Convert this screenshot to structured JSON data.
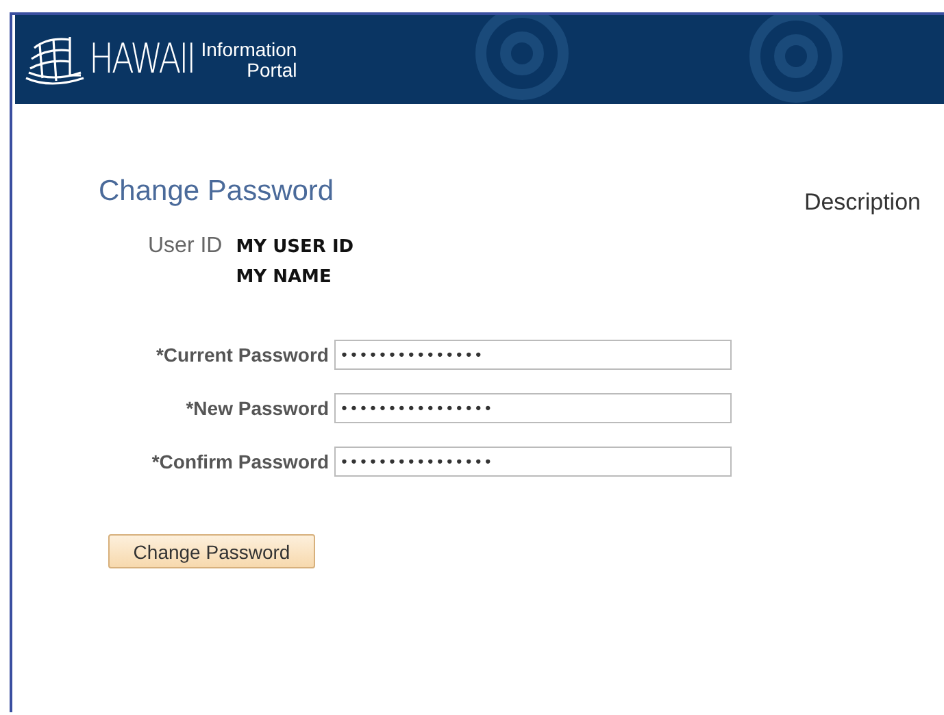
{
  "header": {
    "logo_word": "HAWAII",
    "logo_line_1": "Information",
    "logo_line_2": "Portal"
  },
  "page": {
    "title": "Change Password",
    "description_label": "Description"
  },
  "user": {
    "label": "User ID",
    "user_id": "MY USER ID",
    "name": "MY NAME"
  },
  "fields": [
    {
      "label": "*Current Password",
      "value": "•••••••••••••••"
    },
    {
      "label": "*New Password",
      "value": "••••••••••••••••"
    },
    {
      "label": "*Confirm Password",
      "value": "••••••••••••••••"
    }
  ],
  "button": "Change Password"
}
